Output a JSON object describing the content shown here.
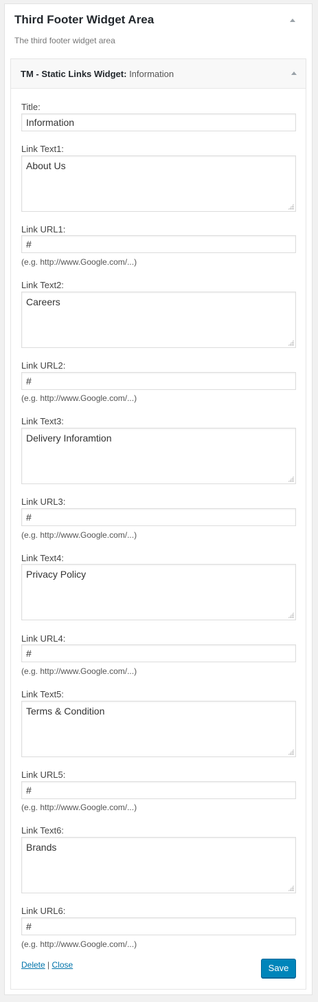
{
  "area": {
    "title": "Third Footer Widget Area",
    "description": "The third footer widget area"
  },
  "widget": {
    "name": "TM - Static Links Widget",
    "instance_title": "Information"
  },
  "form": {
    "title_label": "Title:",
    "title_value": "Information",
    "hint": "(e.g. http://www.Google.com/...)",
    "links": [
      {
        "text_label": "Link Text1:",
        "text_value": "About Us",
        "url_label": "Link URL1:",
        "url_value": "#"
      },
      {
        "text_label": "Link Text2:",
        "text_value": "Careers",
        "url_label": "Link URL2:",
        "url_value": "#"
      },
      {
        "text_label": "Link Text3:",
        "text_value": "Delivery Inforamtion",
        "url_label": "Link URL3:",
        "url_value": "#"
      },
      {
        "text_label": "Link Text4:",
        "text_value": "Privacy Policy",
        "url_label": "Link URL4:",
        "url_value": "#"
      },
      {
        "text_label": "Link Text5:",
        "text_value": "Terms & Condition",
        "url_label": "Link URL5:",
        "url_value": "#"
      },
      {
        "text_label": "Link Text6:",
        "text_value": "Brands",
        "url_label": "Link URL6:",
        "url_value": "#"
      }
    ]
  },
  "actions": {
    "delete_label": "Delete",
    "separator": "|",
    "close_label": "Close",
    "save_label": "Save"
  },
  "colors": {
    "primary_button": "#0085ba",
    "link": "#0073aa"
  }
}
